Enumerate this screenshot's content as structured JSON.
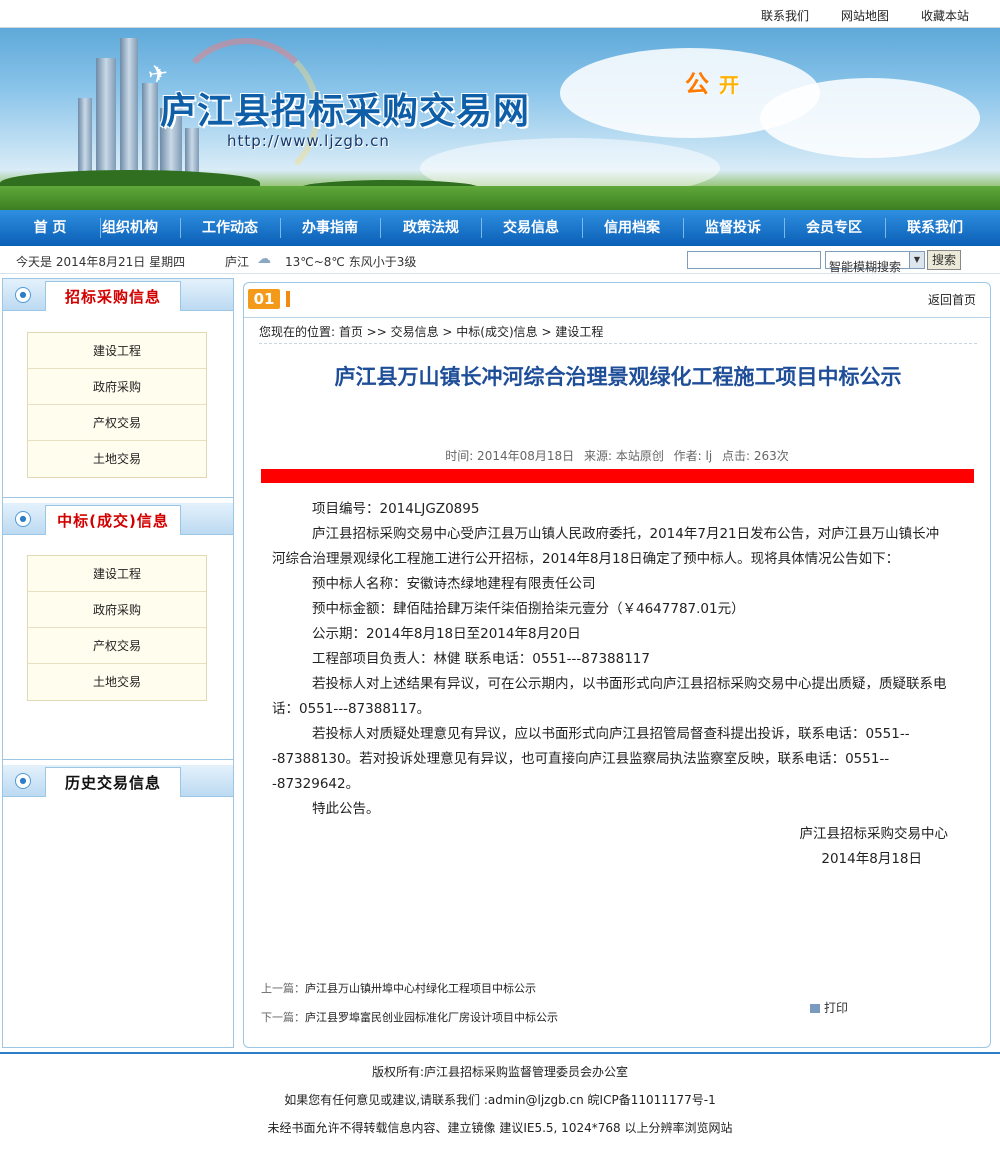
{
  "top_links": [
    "联系我们",
    "网站地图",
    "收藏本站"
  ],
  "banner": {
    "site_title": "庐江县招标采购交易网",
    "site_url": "http://www.ljzgb.cn",
    "slogan_main": "公",
    "slogan_sub": "开"
  },
  "nav": [
    "首 页",
    "组织机构",
    "工作动态",
    "办事指南",
    "政策法规",
    "交易信息",
    "信用档案",
    "监督投诉",
    "会员专区",
    "联系我们"
  ],
  "infobar": {
    "date": "今天是 2014年8月21日 星期四",
    "city": "庐江",
    "weather": "13℃~8℃  东风小于3级",
    "search_placeholder": "",
    "search_mode": "智能模糊搜索",
    "search_button": "搜索"
  },
  "sidebar": {
    "boxes": [
      {
        "title": "招标采购信息",
        "title_color": "#d40000",
        "items": [
          "建设工程",
          "政府采购",
          "产权交易",
          "土地交易"
        ]
      },
      {
        "title": "中标(成交)信息",
        "title_color": "#d40000",
        "items": [
          "建设工程",
          "政府采购",
          "产权交易",
          "土地交易"
        ]
      },
      {
        "title": "历史交易信息",
        "title_color": "#111111",
        "items": []
      }
    ]
  },
  "main": {
    "badge": "01",
    "back_home": "返回首页",
    "breadcrumb": "您现在的位置: 首页  >> 交易信息  > 中标(成交)信息  > 建设工程",
    "title": "庐江县万山镇长冲河综合治理景观绿化工程施工项目中标公示",
    "meta": {
      "time": "时间: 2014年08月18日",
      "source": "来源: 本站原创",
      "author": "作者: lj",
      "clicks": "点击: 263次"
    },
    "paragraphs": [
      "项目编号：2014LJGZ0895",
      "庐江县招标采购交易中心受庐江县万山镇人民政府委托，2014年7月21日发布公告，对庐江县万山镇长冲河综合治理景观绿化工程施工进行公开招标，2014年8月18日确定了预中标人。现将具体情况公告如下：",
      "预中标人名称：安徽诗杰绿地建程有限责任公司",
      "预中标金额：肆佰陆拾肆万柒仟柒佰捌拾柒元壹分（￥4647787.01元）",
      "公示期：2014年8月18日至2014年8月20日",
      "工程部项目负责人：林健   联系电话：0551---87388117",
      "若投标人对上述结果有异议，可在公示期内，以书面形式向庐江县招标采购交易中心提出质疑，质疑联系电话：0551---87388117。",
      "若投标人对质疑处理意见有异议，应以书面形式向庐江县招管局督查科提出投诉，联系电话：0551---87388130。若对投诉处理意见有异议，也可直接向庐江县监察局执法监察室反映，联系电话：0551---87329642。",
      "特此公告。"
    ],
    "signature": "庐江县招标采购交易中心",
    "sign_date": "2014年8月18日",
    "prev_label": "上一篇：",
    "prev_title": "庐江县万山镇卅埠中心村绿化工程项目中标公示",
    "next_label": "下一篇：",
    "next_title": "庐江县罗埠富民创业园标准化厂房设计项目中标公示",
    "print": "打印"
  },
  "footer": [
    "版权所有:庐江县招标采购监督管理委员会办公室",
    "如果您有任何意见或建议,请联系我们 :admin@ljzgb.cn 皖ICP备11011177号-1",
    "未经书面允许不得转载信息内容、建立镜像 建议IE5.5, 1024*768 以上分辨率浏览网站"
  ]
}
